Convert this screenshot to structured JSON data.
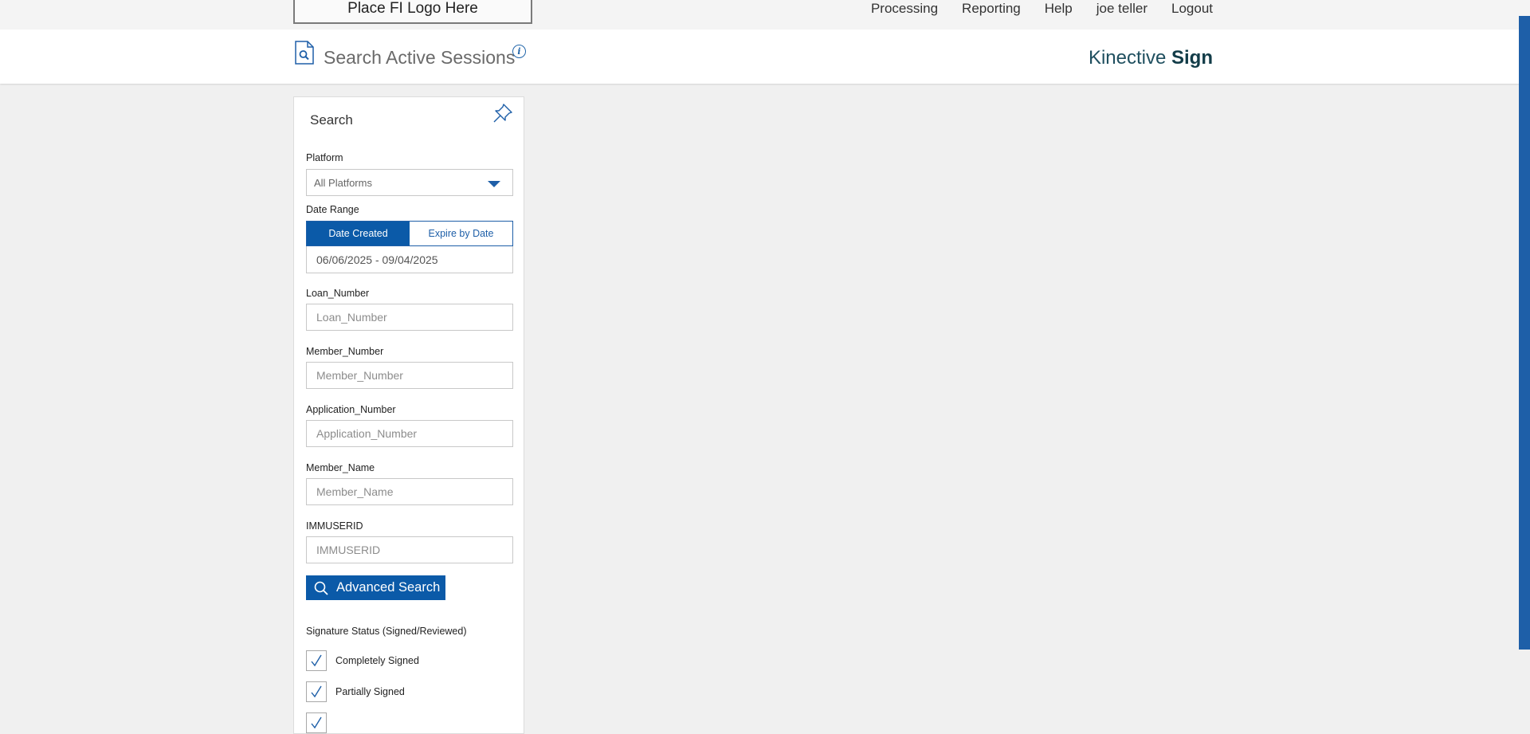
{
  "topbar": {
    "logo_text": "Place FI Logo Here",
    "nav": [
      "Processing",
      "Reporting",
      "Help",
      "joe teller",
      "Logout"
    ]
  },
  "header": {
    "title": "Search Active Sessions",
    "info_icon": "info-icon",
    "brand_prefix": "Kinective",
    "brand_suffix": "Sign"
  },
  "search": {
    "title": "Search",
    "platform_label": "Platform",
    "platform_value": "All Platforms",
    "date_range_label": "Date Range",
    "date_created": "Date Created",
    "expire_by_date": "Expire by Date",
    "date_range_value": "06/06/2025 - 09/04/2025",
    "fields": [
      {
        "label": "Loan_Number",
        "placeholder": "Loan_Number"
      },
      {
        "label": "Member_Number",
        "placeholder": "Member_Number"
      },
      {
        "label": "Application_Number",
        "placeholder": "Application_Number"
      },
      {
        "label": "Member_Name",
        "placeholder": "Member_Name"
      },
      {
        "label": "IMMUSERID",
        "placeholder": "IMMUSERID"
      }
    ],
    "advanced_search": "Advanced Search",
    "signature_status_label": "Signature Status (Signed/Reviewed)",
    "checkboxes": [
      {
        "label": "Completely Signed",
        "checked": true
      },
      {
        "label": "Partially Signed",
        "checked": true
      },
      {
        "label": "",
        "checked": true
      }
    ]
  },
  "colors": {
    "accent": "#0b5aa8",
    "brand_text": "#1f4f5f",
    "page_bg": "#f0f0f0"
  }
}
